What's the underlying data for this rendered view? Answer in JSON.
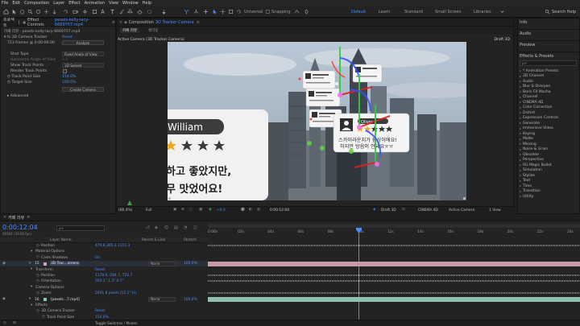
{
  "menu": [
    "File",
    "Edit",
    "Composition",
    "Layer",
    "Effect",
    "Animation",
    "View",
    "Window",
    "Help"
  ],
  "toolbar": {
    "universal": "Universal",
    "snapping": "Snapping",
    "workspaces": [
      {
        "label": "Default",
        "active": true
      },
      {
        "label": "Learn",
        "active": false
      },
      {
        "label": "Standard",
        "active": false
      },
      {
        "label": "Small Screen",
        "active": false
      },
      {
        "label": "Libraries",
        "active": false
      }
    ],
    "search_help": "Search Help"
  },
  "project_tabs": {
    "project": "프로젝트",
    "effect_controls": "Effect Controls",
    "effect_controls_file": "pexels-kelly-lacy-6669757.mp4"
  },
  "effect_controls": {
    "path": "카페 리뷰 · pexels-kelly-lacy-6669757.mp4",
    "effect_name": "3D Camera Tracker",
    "reset": "Reset",
    "frames": "723 frames @ 0:00:00:00",
    "analyze": "Analyze",
    "shot_type_label": "Shot Type",
    "shot_type_value": "Fixed Angle of View",
    "horizontal_aov_label": "Horizontal Angle of View",
    "horizontal_aov_value": "0.0",
    "show_track_points_label": "Show Track Points",
    "show_track_points_value": "3D Solved",
    "render_track_points_label": "Render Track Points",
    "track_point_size_label": "Track Point Size",
    "track_point_size_value": "154.0%",
    "target_size_label": "Target Size",
    "target_size_value": "100.0%",
    "create_camera": "Create Camera",
    "advanced_label": "Advanced"
  },
  "composition": {
    "tab_label": "Composition",
    "tab_name": "3D Tracker Camera",
    "sub_tabs": [
      "카페 리뷰",
      "렌더링"
    ],
    "active_camera": "Active Camera (3D Tracker Camera)",
    "renderer": "Draft 3D",
    "footer": {
      "zoom": "(66.4%)",
      "quality": "Full",
      "exposure": "+0.0",
      "timecode": "0:00:12:04",
      "renderer_btn": "Draft 3D",
      "cinema": "CINEMA 4D",
      "camera": "Active Camera",
      "views": "1 View"
    },
    "cards": {
      "main_name": "William",
      "main_line1": "하고 좋았지만,",
      "main_line2": "무 맛었어요!",
      "oliver_name": "Oliver",
      "oliver_line1": "스카이라운지가 환상이에요!",
      "oliver_line2": "하지만 방음이 안돼요ㅠㅠ"
    }
  },
  "right_panel": {
    "info": "Info",
    "audio": "Audio",
    "preview": "Preview",
    "effects_presets": "Effects & Presets",
    "search_placeholder": "ρ+",
    "categories": [
      "* Animation Presets",
      "3D Channel",
      "Audio",
      "Blur & Sharpen",
      "Boris FX Mocha",
      "Channel",
      "CINEMA 4D",
      "Color Correction",
      "Distort",
      "Expression Controls",
      "Generate",
      "Immersive Video",
      "Keying",
      "Matte",
      "Missing",
      "Noise & Grain",
      "Obsolete",
      "Perspective",
      "RG Magic Bullet",
      "Simulation",
      "Stylize",
      "Text",
      "Time",
      "Transition",
      "Utility"
    ]
  },
  "timeline": {
    "tab_name": "카페 리뷰",
    "timecode": "0:00:12:04",
    "frames_info": "00364 (30.00 fps)",
    "search_placeholder": "ρ+",
    "col_layer_name": "Layer Name",
    "col_parent": "Parent & Link",
    "col_stretch": "Stretch",
    "ruler": [
      "0:00s",
      "02s",
      "04s",
      "06s",
      "08s",
      "10s",
      "12s",
      "14s",
      "16s",
      "18s",
      "20s",
      "22s",
      "24s"
    ],
    "rows": [
      {
        "indent": 3,
        "label": "Position",
        "value": "479.8,305.2,1111.3",
        "kind": "prop"
      },
      {
        "indent": 2,
        "label": "Material Options",
        "value": "",
        "kind": "group"
      },
      {
        "indent": 3,
        "label": "Casts Shadows",
        "value": "On",
        "kind": "prop"
      },
      {
        "num": "15",
        "label": "3D Trac...amera",
        "parent": "None",
        "stretch": "100.0%",
        "kind": "layer",
        "selected": true
      },
      {
        "indent": 2,
        "label": "Transform",
        "value": "Reset",
        "kind": "group"
      },
      {
        "indent": 3,
        "label": "Position",
        "value": "1178.6,-294.7,-722.7",
        "kind": "prop"
      },
      {
        "indent": 3,
        "label": "Orientation",
        "value": "359.1°,1.3°,0.7°",
        "kind": "prop"
      },
      {
        "indent": 2,
        "label": "Camera Options",
        "value": "",
        "kind": "group"
      },
      {
        "indent": 3,
        "label": "Zoom",
        "value": "2041.8 pixels (15.1° H)",
        "kind": "prop"
      },
      {
        "num": "16",
        "label": "[pexels...7.mp4]",
        "parent": "None",
        "stretch": "100.0%",
        "kind": "layer",
        "selected": false
      },
      {
        "indent": 2,
        "label": "Effects",
        "value": "",
        "kind": "group"
      },
      {
        "indent": 3,
        "label": "3D Camera Tracker",
        "value": "Reset",
        "kind": "prop"
      },
      {
        "indent": 4,
        "label": "Track Point Size",
        "value": "154.0%",
        "kind": "prop"
      }
    ],
    "toggle_label": "Toggle Switches / Modes"
  }
}
